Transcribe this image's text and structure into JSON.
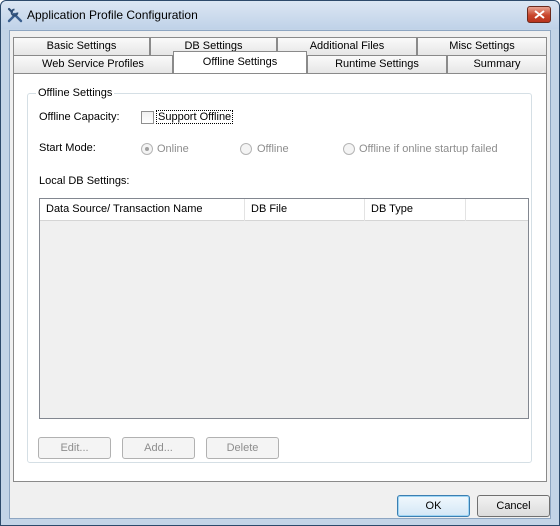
{
  "window": {
    "title": "Application Profile Configuration",
    "icon": "tools-icon",
    "close_icon": "close-icon"
  },
  "tabs": {
    "row_back": [
      "Basic Settings",
      "DB Settings",
      "Additional Files",
      "Misc Settings"
    ],
    "row_front": [
      "Web Service Profiles",
      "Offline Settings",
      "Runtime Settings",
      "Summary"
    ],
    "active": "Offline Settings"
  },
  "offline": {
    "group_title": "Offline Settings",
    "capacity_label": "Offline Capacity:",
    "support_offline_label": "Support Offline",
    "support_offline_checked": false,
    "start_mode_label": "Start Mode:",
    "start_modes": [
      "Online",
      "Offline",
      "Offline if online startup failed"
    ],
    "start_mode_selected": "Online",
    "local_db_label": "Local DB Settings:",
    "columns": [
      "Data Source/ Transaction Name",
      "DB File",
      "DB Type"
    ],
    "rows": [],
    "edit_label": "Edit...",
    "add_label": "Add...",
    "delete_label": "Delete"
  },
  "footer": {
    "ok_label": "OK",
    "cancel_label": "Cancel"
  },
  "colors": {
    "title_bg": "#c3d4e7",
    "close_button": "#c9462c",
    "default_button_border": "#3c7fb1"
  }
}
